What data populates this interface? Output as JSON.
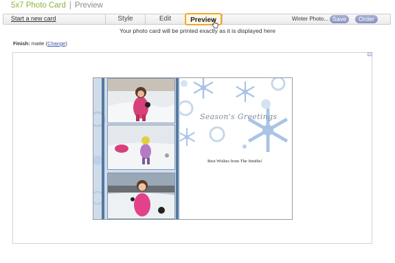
{
  "header": {
    "title": "5x7 Photo Card",
    "separator": "|",
    "subtitle": "Preview"
  },
  "toolbar": {
    "start_link": "Start a new card",
    "tabs": [
      {
        "label": "Style",
        "active": false
      },
      {
        "label": "Edit",
        "active": false
      },
      {
        "label": "Preview",
        "active": true
      }
    ],
    "project_name": "Winter Photo...",
    "save_label": "Save",
    "order_label": "Order"
  },
  "info_text": "Your photo card will be printed exactly as it is displayed here",
  "finish": {
    "label": "Finish:",
    "value": "matte",
    "change_label": "Change"
  },
  "card": {
    "greeting": "Season's Greetings",
    "message": "Best Wishes from The Smiths!",
    "photos": [
      "child in snow with snowball",
      "child playing in snow",
      "child in pink snowsuit"
    ]
  },
  "colors": {
    "brand": "#8cb43a",
    "active_tab_border": "#f4a62a",
    "pill_button": "#8590bf",
    "card_stripe": "#5577a0",
    "snowflake": "#a9c4e4"
  }
}
